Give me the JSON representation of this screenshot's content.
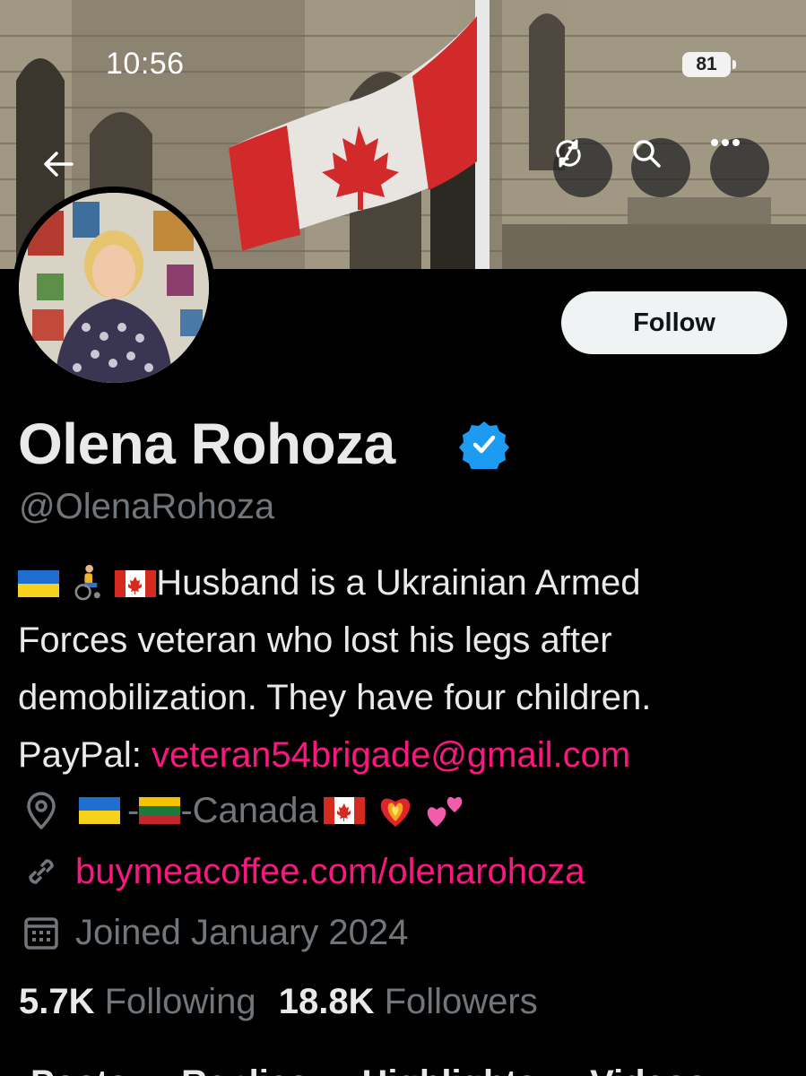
{
  "status_bar": {
    "time": "10:56",
    "battery": "81"
  },
  "banner": {
    "back_icon": "arrow-left-icon",
    "icons": [
      "sync-icon",
      "search-icon",
      "more-icon"
    ]
  },
  "profile": {
    "display_name": "Olena Rohoza",
    "handle": "@OlenaRohoza",
    "follow_label": "Follow",
    "bio": {
      "line1_text": "Husband is a Ukrainian Armed",
      "line2": "Forces veteran who lost his legs after",
      "line3": "demobilization. They have four children.",
      "paypal_label": "PayPal: ",
      "paypal_email": "veteran54brigade@gmail.com"
    },
    "location": {
      "sep1": " -",
      "sep2": "-Canada "
    },
    "website": "buymeacoffee.com/olenarohoza",
    "joined": "Joined January 2024",
    "following_count": "5.7K",
    "following_label": "Following",
    "followers_count": "18.8K",
    "followers_label": "Followers"
  },
  "tabs": [
    "Posts",
    "Replies",
    "Highlights",
    "Videos"
  ],
  "colors": {
    "accent_link": "#f91880",
    "verified": "#1d9bf0",
    "muted": "#71767b"
  }
}
